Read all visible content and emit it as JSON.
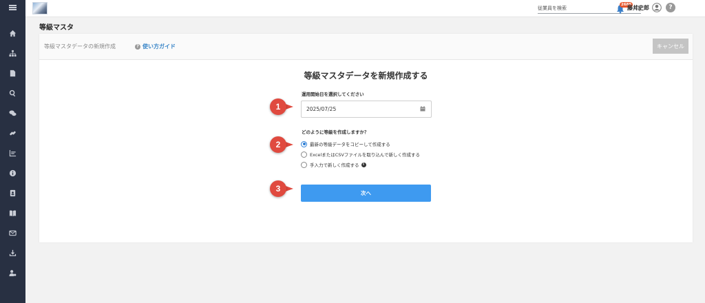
{
  "sidebar": {
    "menu_icon": "hamburger-icon",
    "items": [
      {
        "name": "home",
        "icon": "home-icon"
      },
      {
        "name": "org",
        "icon": "org-chart-icon"
      },
      {
        "name": "document",
        "icon": "document-icon"
      },
      {
        "name": "search",
        "icon": "search-icon"
      },
      {
        "name": "chat",
        "icon": "chat-icon"
      },
      {
        "name": "link",
        "icon": "link-icon"
      },
      {
        "name": "chart",
        "icon": "bar-chart-icon"
      },
      {
        "name": "info",
        "icon": "info-icon"
      },
      {
        "name": "contacts",
        "icon": "contact-book-icon"
      },
      {
        "name": "book",
        "icon": "book-icon"
      },
      {
        "name": "mail",
        "icon": "mail-icon"
      },
      {
        "name": "download",
        "icon": "download-icon"
      },
      {
        "name": "user-settings",
        "icon": "user-settings-icon"
      }
    ]
  },
  "topbar": {
    "search_placeholder": "従業員を検索",
    "notification_count": "2685",
    "user_name": "藤井史郎",
    "help_label": "?"
  },
  "page": {
    "title": "等級マスタ"
  },
  "card": {
    "subtitle": "等級マスタデータの新規作成",
    "guide_link": "使い方ガイド",
    "cancel_label": "キャンセル",
    "form_title": "等級マスタデータを新規作成する",
    "date_label": "運用開始日を選択してください",
    "date_value": "2025/07/25",
    "method_label": "どのように等級を作成しますか？",
    "options": [
      {
        "label": "最新の等級データをコピーして作成する",
        "selected": true
      },
      {
        "label": "ExcelまたはCSVファイルを取り込んで新しく作成する",
        "selected": false
      },
      {
        "label": "手入力で新しく作成する",
        "selected": false
      }
    ],
    "next_label": "次へ"
  },
  "markers": [
    "1",
    "2",
    "3"
  ],
  "colors": {
    "sidebar_bg": "#283042",
    "primary": "#3e9af0",
    "marker": "#e04a3f",
    "badge": "#e8572c",
    "link": "#3a86c8"
  }
}
